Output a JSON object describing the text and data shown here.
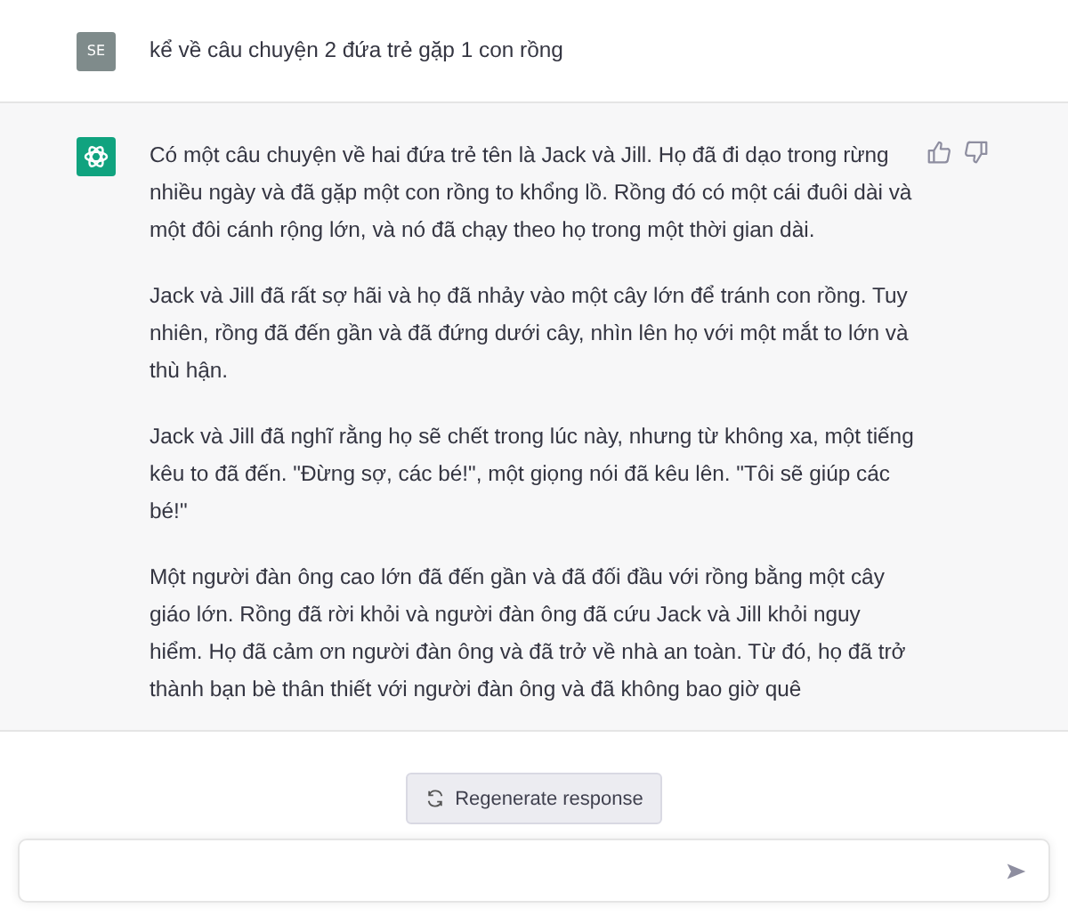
{
  "messages": [
    {
      "kind": "user",
      "avatar": "SE",
      "paragraphs": [
        "kể về câu chuyện 2 đứa trẻ gặp 1 con rồng"
      ]
    },
    {
      "kind": "assistant",
      "paragraphs": [
        "Có một câu chuyện về hai đứa trẻ tên là Jack và Jill. Họ đã đi dạo trong rừng nhiều ngày và đã gặp một con rồng to khổng lồ. Rồng đó có một cái đuôi dài và một đôi cánh rộng lớn, và nó đã chạy theo họ trong một thời gian dài.",
        "Jack và Jill đã rất sợ hãi và họ đã nhảy vào một cây lớn để tránh con rồng. Tuy nhiên, rồng đã đến gần và đã đứng dưới cây, nhìn lên họ với một mắt to lớn và thù hận.",
        "Jack và Jill đã nghĩ rằng họ sẽ chết trong lúc này, nhưng từ không xa, một tiếng kêu to đã đến. \"Đừng sợ, các bé!\", một giọng nói đã kêu lên. \"Tôi sẽ giúp các bé!\"",
        "Một người đàn ông cao lớn đã đến gần và đã đối đầu với rồng bằng một cây giáo lớn. Rồng đã rời khỏi và người đàn ông đã cứu Jack và Jill khỏi nguy hiểm. Họ đã cảm ơn người đàn ông và đã trở về nhà an toàn. Từ đó, họ đã trở thành bạn bè thân thiết với người đàn ông và đã không bao giờ quê"
      ]
    }
  ],
  "regenerate_button": "Regenerate response"
}
